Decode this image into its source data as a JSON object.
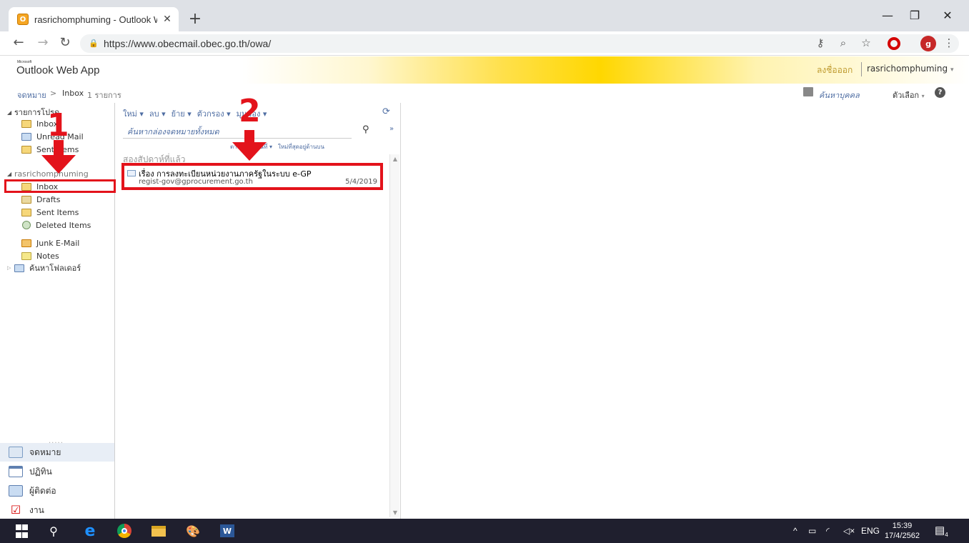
{
  "browser": {
    "tab_title": "rasrichomphuming - Outlook We",
    "favicon_letter": "O",
    "new_tab": "+",
    "url": "https://www.obecmail.obec.go.th/owa/",
    "profile_initial": "g"
  },
  "owa": {
    "brand_small": "Microsoft",
    "logo": "Outlook Web App",
    "sign_out": "ลงชื่อออก",
    "user": "rasrichomphuming",
    "breadcrumb": {
      "root": "จดหมาย",
      "current": "Inbox",
      "count": "1 รายการ"
    },
    "address_book": "ค้นหาบุคคล",
    "options": "ตัวเลือก"
  },
  "favorites": {
    "header": "รายการโปรด",
    "items": [
      {
        "label": "Inbox",
        "icon": "folder-icon"
      },
      {
        "label": "Unread Mail",
        "icon": "search-folder-icon"
      },
      {
        "label": "Sent Items",
        "icon": "folder-icon"
      }
    ]
  },
  "mailbox": {
    "header": "rasrichomphuming",
    "items": [
      {
        "label": "Inbox",
        "icon": "inbox-icon"
      },
      {
        "label": "Drafts",
        "icon": "drafts-icon"
      },
      {
        "label": "Sent Items",
        "icon": "sent-icon"
      },
      {
        "label": "Deleted Items",
        "icon": "deleted-icon"
      },
      {
        "label": "Junk E-Mail",
        "icon": "junk-icon"
      },
      {
        "label": "Notes",
        "icon": "notes-icon"
      },
      {
        "label": "ค้นหาโฟลเดอร์",
        "icon": "search-folder-icon"
      }
    ]
  },
  "nav": {
    "dots": ".....",
    "mail": "จดหมาย",
    "calendar": "ปฏิทิน",
    "contacts": "ผู้ติดต่อ",
    "tasks": "งาน"
  },
  "list": {
    "toolbar": [
      "ใหม่ ▾",
      "ลบ ▾",
      "ย้าย ▾",
      "ตัวกรอง ▾",
      "มุมมอง ▾"
    ],
    "search_placeholder": "ค้นหากล่องจดหมายทั้งหมด",
    "sort": {
      "by": "ตามลำดับ วันที่ ▾",
      "order": "ใหม่ที่สุดอยู่ด้านบน"
    },
    "group": "สองสัปดาห์ที่แล้ว",
    "messages": [
      {
        "subject": "เรื่อง การลงทะเบียนหน่วยงานภาครัฐในระบบ e-GP",
        "sender": "regist-gov@gprocurement.go.th",
        "date": "5/4/2019"
      }
    ]
  },
  "annotations": {
    "step1": "1",
    "step2": "2",
    "color": "#e3131b"
  },
  "taskbar": {
    "lang": "ENG",
    "time": "15:39",
    "date": "17/4/2562",
    "notifications": "4"
  }
}
